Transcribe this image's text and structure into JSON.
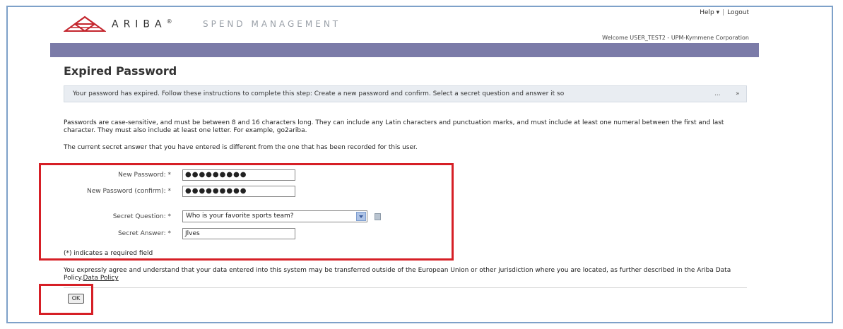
{
  "header": {
    "brand": "ARIBA",
    "brand_mark": "®",
    "product": "SPEND MANAGEMENT",
    "help_label": "Help ▾",
    "logout_label": "Logout",
    "welcome": "Welcome USER_TEST2 - UPM-Kymmene Corporation"
  },
  "page": {
    "title": "Expired Password",
    "info_message": "Your password has expired.  Follow these instructions to complete this step: Create a new password and confirm. Select a secret question and answer it so",
    "info_more": "...",
    "info_expand": "»",
    "rules_text": "Passwords are case-sensitive, and must be between 8 and 16 characters long. They can include any Latin characters and punctuation marks, and must include at least one numeral between the first and last character. They must also include at least one letter. For example, go2ariba.",
    "secret_notice": "The current secret answer that you have entered is different from the one that has been recorded for this user."
  },
  "form": {
    "new_password_label": "New Password:",
    "new_password_value": "●●●●●●●●●",
    "confirm_password_label": "New Password (confirm):",
    "confirm_password_value": "●●●●●●●●●",
    "secret_question_label": "Secret Question:",
    "secret_question_value": "Who is your favorite sports team?",
    "secret_answer_label": "Secret Answer:",
    "secret_answer_value": "Jlves",
    "required_marker": "*",
    "required_note": "(*) indicates a required field"
  },
  "footer": {
    "policy_text": "You expressly agree and understand that your data entered into this system may be transferred outside of the European Union or other jurisdiction where you are located, as further described in the Ariba Data Policy.",
    "policy_link": "Data Policy",
    "ok_label": "OK"
  },
  "icons": {
    "logo": "ariba-logo-icon",
    "info": "info-icon",
    "dropdown": "chevron-down-icon"
  },
  "colors": {
    "navbar": "#7b7ba8",
    "highlight_box": "#d61f26",
    "frame": "#7ea1c9",
    "info_box": "#e9edf2"
  }
}
